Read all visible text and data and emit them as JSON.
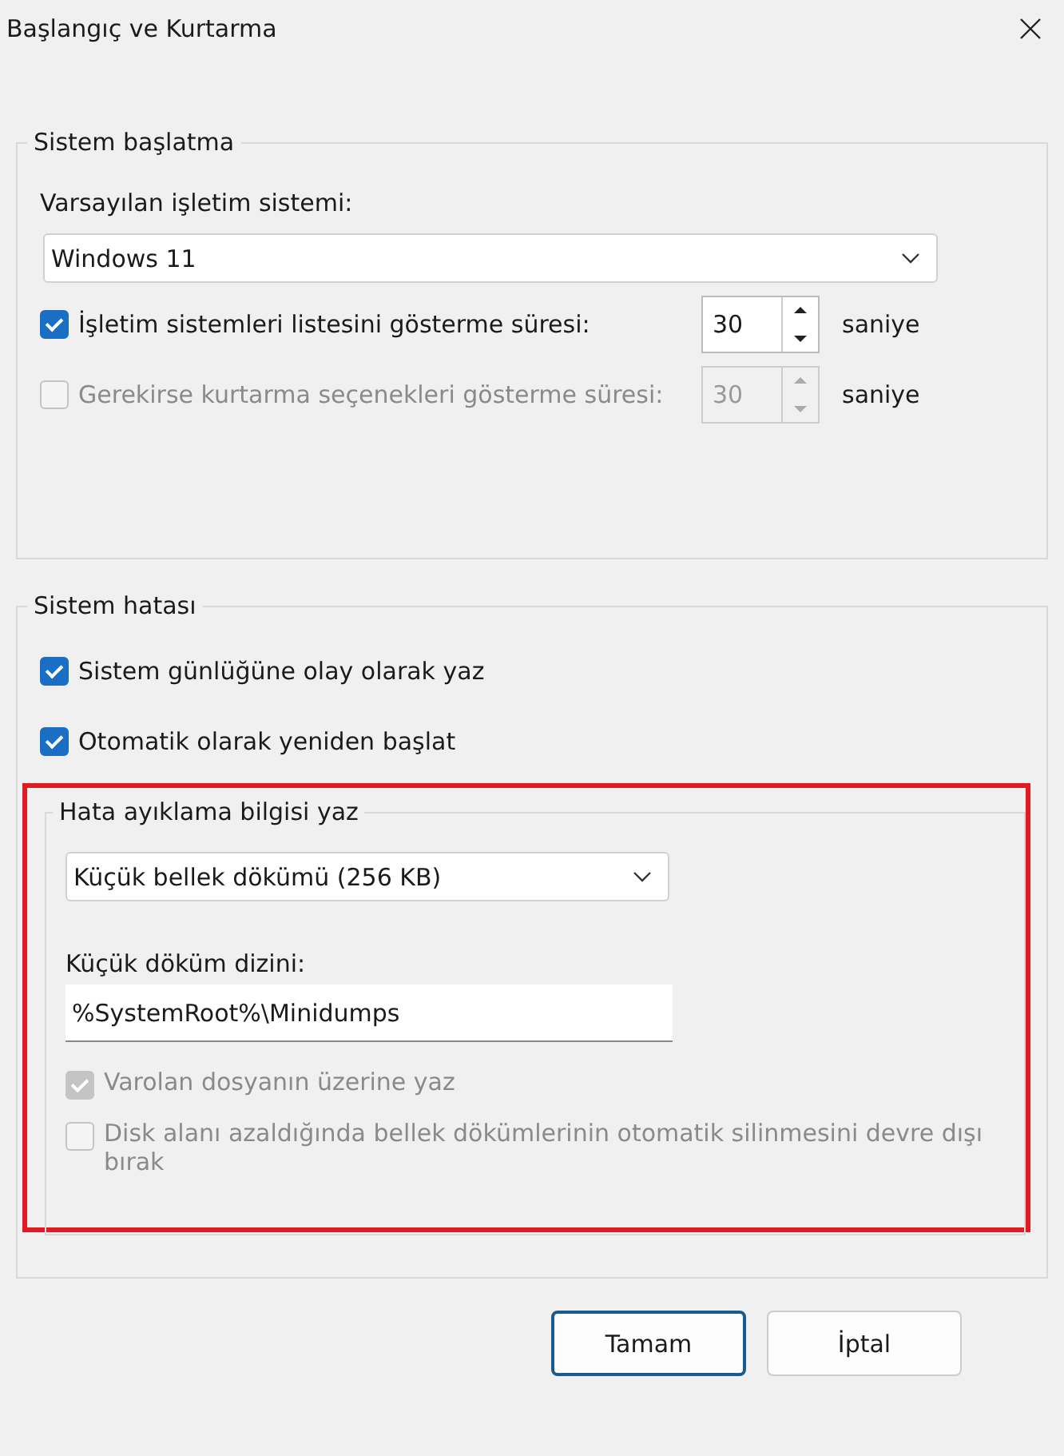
{
  "window": {
    "title": "Başlangıç ve Kurtarma"
  },
  "startup": {
    "title": "Sistem başlatma",
    "os_label": "Varsayılan işletim sistemi:",
    "os_value": "Windows 11",
    "options": [
      {
        "label": "İşletim sistemleri listesini gösterme süresi:",
        "checked": true,
        "value": "30",
        "unit": "saniye",
        "disabled": false
      },
      {
        "label": "Gerekirse kurtarma seçenekleri gösterme süresi:",
        "checked": false,
        "value": "30",
        "unit": "saniye",
        "disabled": true
      }
    ]
  },
  "failure": {
    "title": "Sistem hatası",
    "options": [
      {
        "label": "Sistem günlüğüne olay olarak yaz",
        "checked": true
      },
      {
        "label": "Otomatik olarak yeniden başlat",
        "checked": true
      }
    ],
    "debug": {
      "title": "Hata ayıklama bilgisi yaz",
      "dump_value": "Küçük bellek dökümü (256 KB)",
      "dir_label": "Küçük döküm dizini:",
      "dir_value": "%SystemRoot%\\Minidumps",
      "options": [
        {
          "label": "Varolan dosyanın üzerine yaz",
          "checked": true,
          "disabled": true
        },
        {
          "label": "Disk alanı azaldığında bellek dökümlerinin otomatik silinmesini devre dışı bırak",
          "checked": false,
          "disabled": true
        }
      ]
    }
  },
  "buttons": [
    {
      "label": "Tamam",
      "default": true
    },
    {
      "label": "İptal",
      "default": false
    }
  ]
}
